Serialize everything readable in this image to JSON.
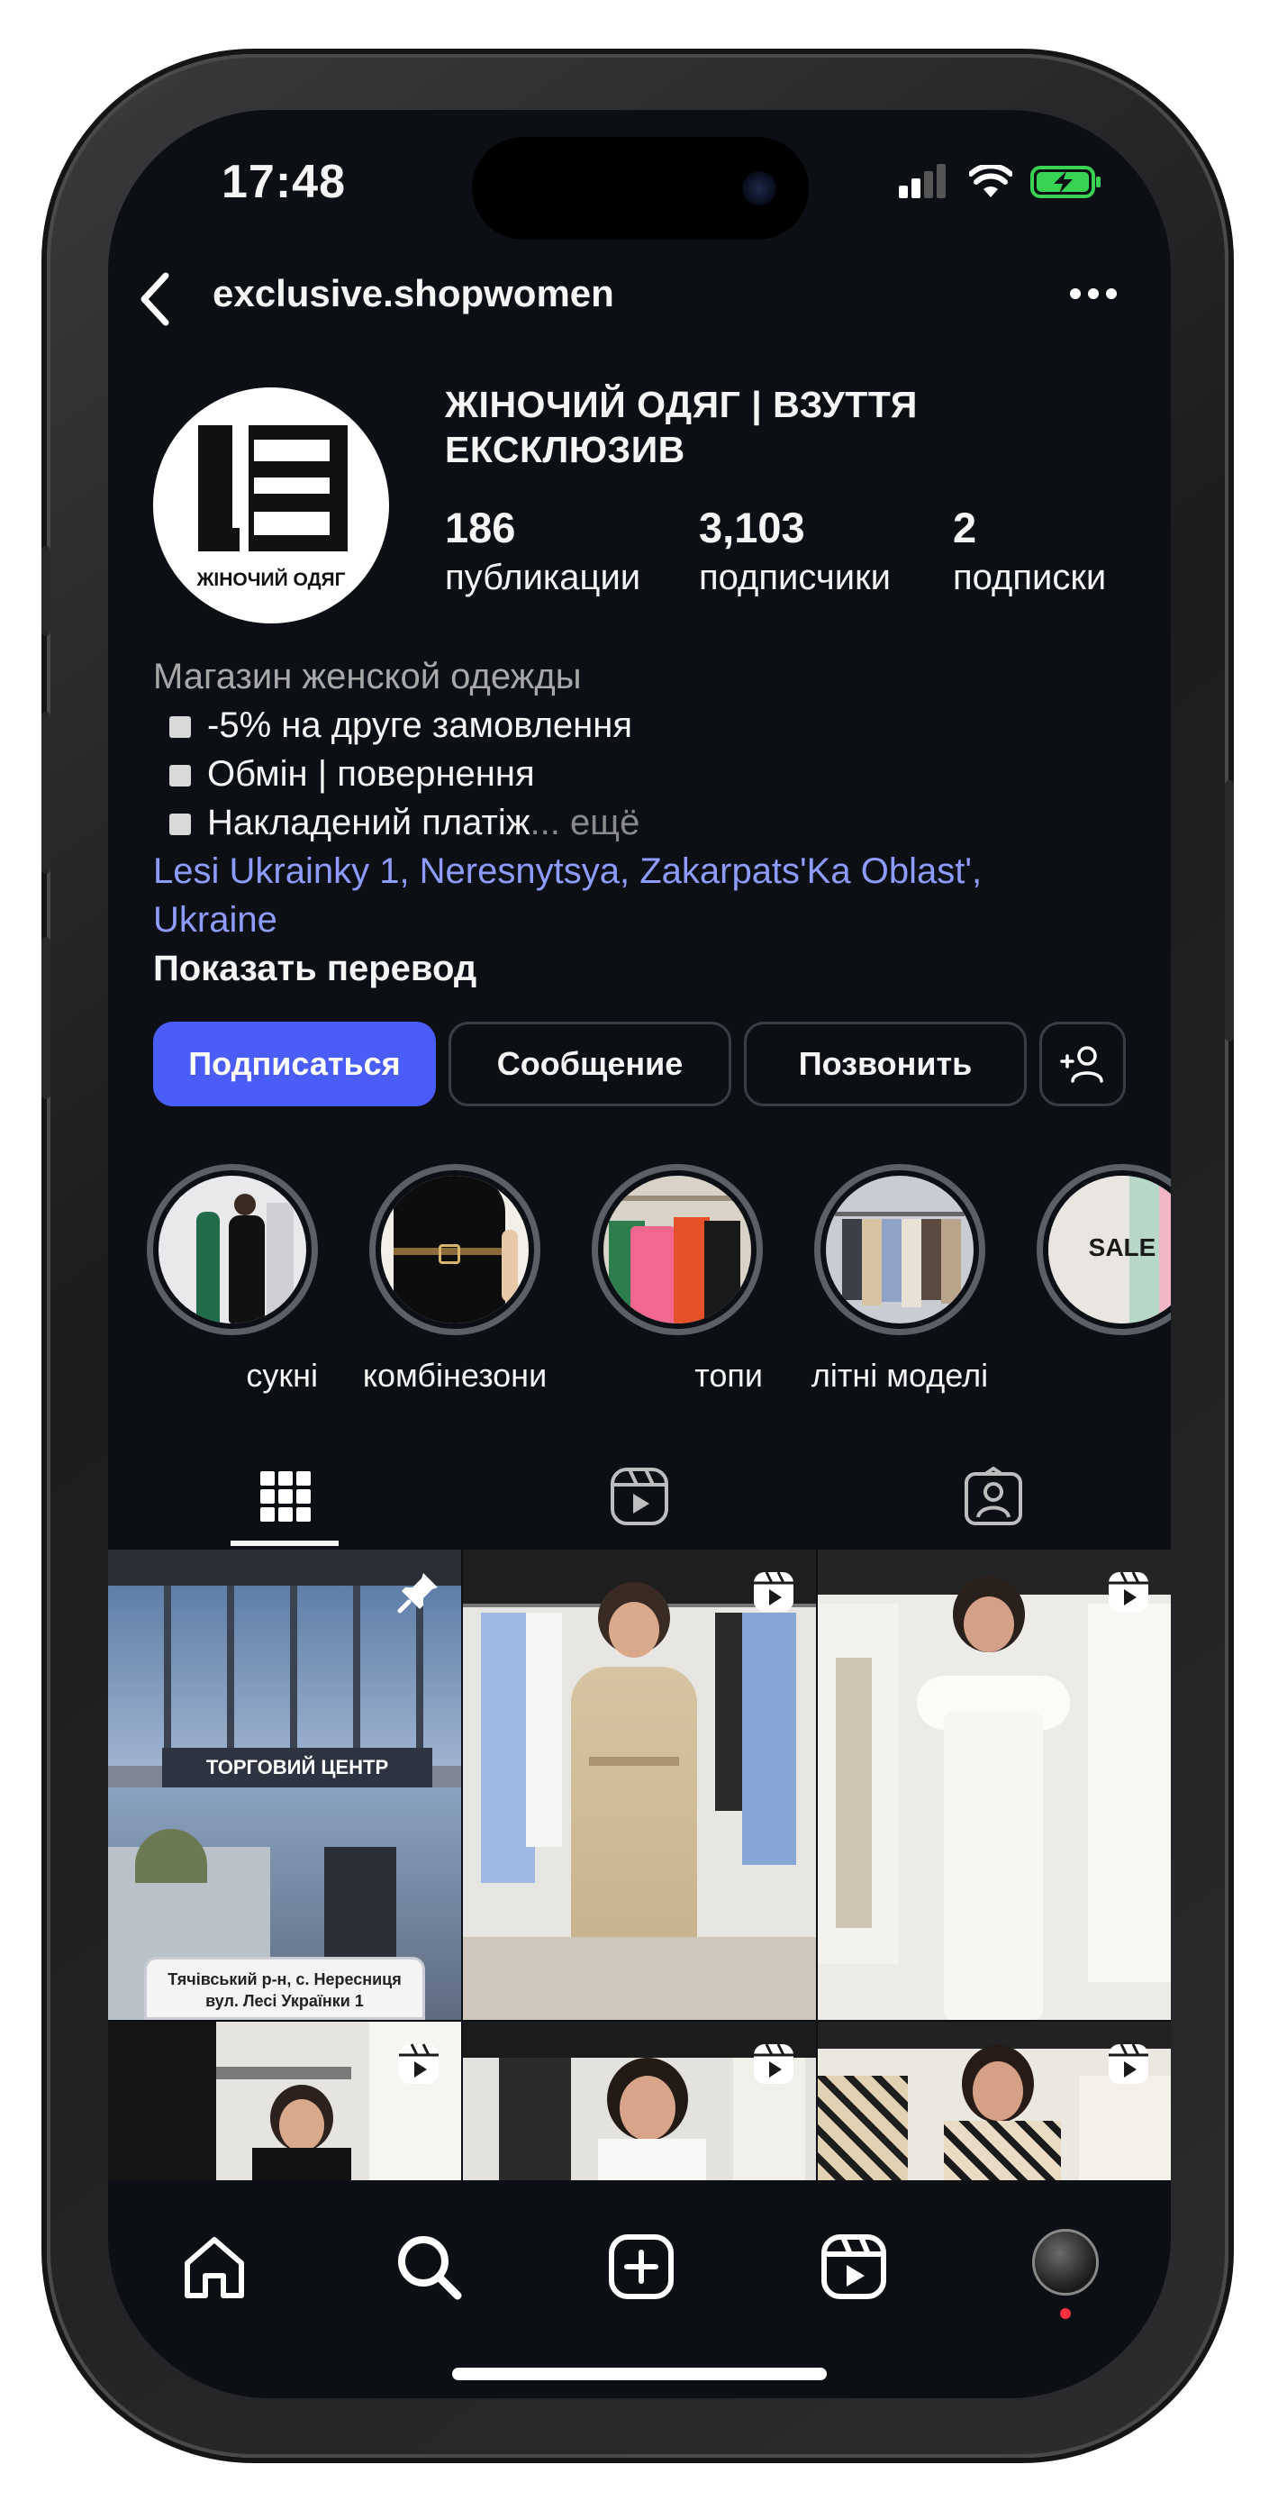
{
  "status_bar": {
    "time": "17:48"
  },
  "header": {
    "username": "exclusive.shopwomen"
  },
  "profile": {
    "logo_text": "ЖІНОЧИЙ ОДЯГ",
    "name": "ЖІНОЧИЙ ОДЯГ | ВЗУТТЯ ЕКСКЛЮЗИВ",
    "stats": [
      {
        "value": "186",
        "label": "публикации"
      },
      {
        "value": "3,103",
        "label": "подписчики"
      },
      {
        "value": "2",
        "label": "подписки"
      }
    ],
    "category": "Магазин женской одежды",
    "bio_lines": [
      "-5% на друге замовлення",
      "Обмін | повернення",
      "Накладений платіж"
    ],
    "more": "... ещё",
    "location_line1": "Lesi Ukrainky 1, Neresnytsya, Zakarpats'Ka Oblast',",
    "location_line2": "Ukraine",
    "translate": "Показать перевод"
  },
  "actions": {
    "follow": "Подписаться",
    "message": "Сообщение",
    "call": "Позвонить"
  },
  "highlights": [
    {
      "label": "сукні"
    },
    {
      "label": "комбінезони"
    },
    {
      "label": "топи"
    },
    {
      "label": "літні моделі"
    },
    {
      "label": "SALE"
    }
  ],
  "posts": {
    "first_sign": "ТОРГОВИЙ ЦЕНТР",
    "first_caption_1": "Тячівський р-н, с. Нересниця",
    "first_caption_2": "вул. Лесі Українки 1"
  },
  "colors": {
    "accent": "#4a5df9",
    "background": "#0c0f14",
    "link": "#8e9bff",
    "notification": "#ff3040"
  }
}
